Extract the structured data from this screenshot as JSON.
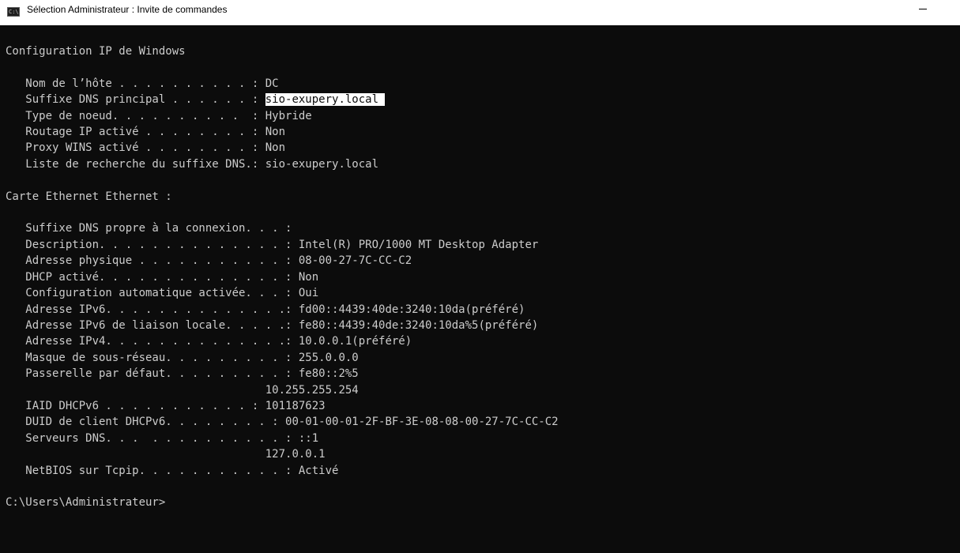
{
  "window": {
    "icon_text": "C:\\",
    "title": "Sélection Administrateur : Invite de commandes",
    "minimize_icon": "minimize-icon"
  },
  "colors": {
    "console_bg": "#0c0c0c",
    "console_fg": "#cccccc",
    "selection_bg": "#ffffff",
    "titlebar_bg": "#ffffff"
  },
  "console": {
    "header": "Configuration IP de Windows",
    "host": [
      {
        "label": "   Nom de l’hôte . . . . . . . . . . : ",
        "value": "DC"
      },
      {
        "label": "   Suffixe DNS principal . . . . . . : ",
        "value": "sio-exupery.local ",
        "selected": true
      },
      {
        "label": "   Type de noeud. . . . . . . . . .  : ",
        "value": "Hybride"
      },
      {
        "label": "   Routage IP activé . . . . . . . . : ",
        "value": "Non"
      },
      {
        "label": "   Proxy WINS activé . . . . . . . . : ",
        "value": "Non"
      },
      {
        "label": "   Liste de recherche du suffixe DNS.: ",
        "value": "sio-exupery.local"
      }
    ],
    "adapter_header": "Carte Ethernet Ethernet :",
    "adapter": [
      {
        "label": "   Suffixe DNS propre à la connexion. . . : ",
        "value": ""
      },
      {
        "label": "   Description. . . . . . . . . . . . . . : ",
        "value": "Intel(R) PRO/1000 MT Desktop Adapter"
      },
      {
        "label": "   Adresse physique . . . . . . . . . . . : ",
        "value": "08-00-27-7C-CC-C2"
      },
      {
        "label": "   DHCP activé. . . . . . . . . . . . . . : ",
        "value": "Non"
      },
      {
        "label": "   Configuration automatique activée. . . : ",
        "value": "Oui"
      },
      {
        "label": "   Adresse IPv6. . . . . . . . . . . . . .: ",
        "value": "fd00::4439:40de:3240:10da(préféré)"
      },
      {
        "label": "   Adresse IPv6 de liaison locale. . . . .: ",
        "value": "fe80::4439:40de:3240:10da%5(préféré)"
      },
      {
        "label": "   Adresse IPv4. . . . . . . . . . . . . .: ",
        "value": "10.0.0.1(préféré)"
      },
      {
        "label": "   Masque de sous-réseau. . . . . . . . . : ",
        "value": "255.0.0.0"
      },
      {
        "label": "   Passerelle par défaut. . . . . . . . . : ",
        "value": "fe80::2%5"
      },
      {
        "label": "                                       ",
        "value": "10.255.255.254"
      },
      {
        "label": "   IAID DHCPv6 . . . . . . . . . . . : ",
        "value": "101187623"
      },
      {
        "label": "   DUID de client DHCPv6. . . . . . . . : ",
        "value": "00-01-00-01-2F-BF-3E-08-08-00-27-7C-CC-C2"
      },
      {
        "label": "   Serveurs DNS. . .  . . . . . . . . . . : ",
        "value": "::1"
      },
      {
        "label": "                                       ",
        "value": "127.0.0.1"
      },
      {
        "label": "   NetBIOS sur Tcpip. . . . . . . . . . . : ",
        "value": "Activé"
      }
    ],
    "prompt": "C:\\Users\\Administrateur>"
  }
}
